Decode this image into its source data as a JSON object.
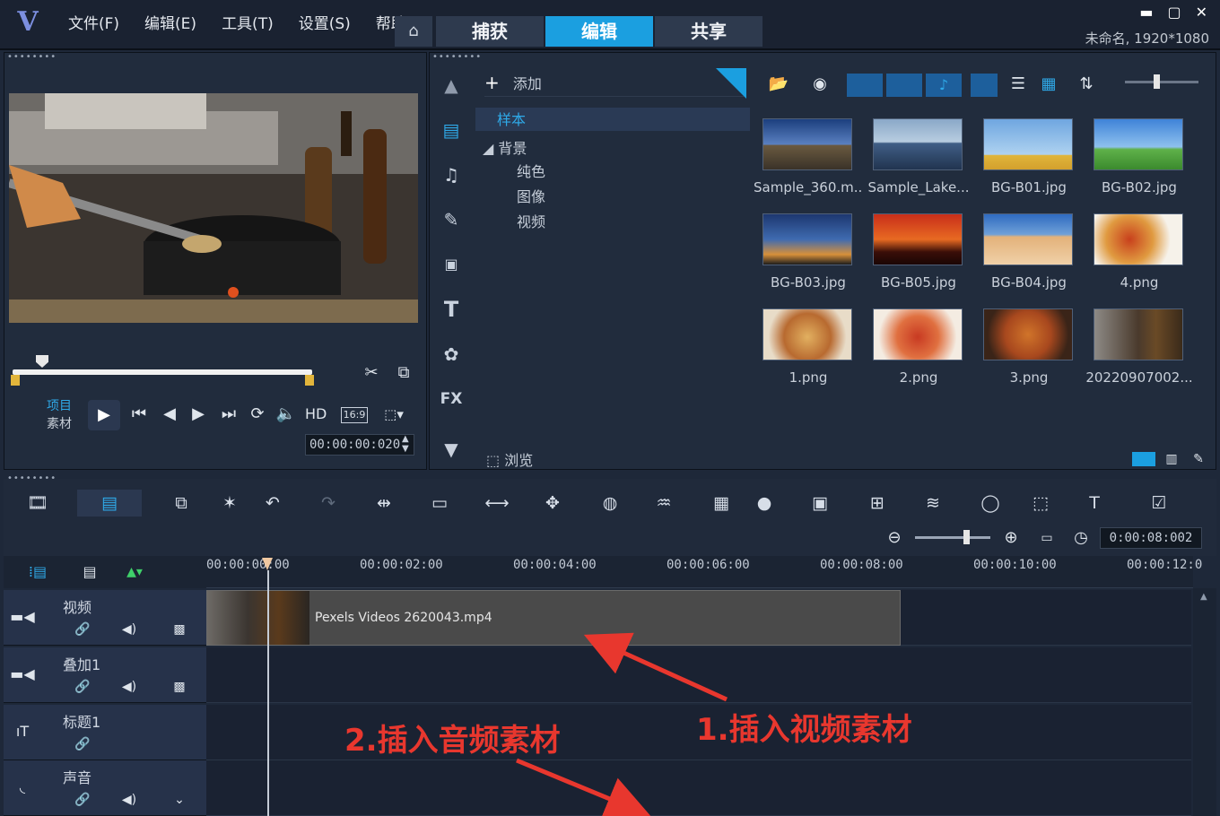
{
  "app": {
    "menu": [
      "文件(F)",
      "编辑(E)",
      "工具(T)",
      "设置(S)",
      "帮助"
    ],
    "tabs": [
      {
        "label": "捕获",
        "active": false
      },
      {
        "label": "编辑",
        "active": true
      },
      {
        "label": "共享",
        "active": false
      }
    ],
    "project_info": "未命名, 1920*1080",
    "accent_color": "#1b9fe0"
  },
  "player": {
    "mode_project": "项目",
    "mode_clip": "素材",
    "hd_label": "HD",
    "aspect_label": "16:9",
    "timecode": "00:00:00:020"
  },
  "library": {
    "add_label": "添加",
    "browse_label": "浏览",
    "tree": {
      "sample": "样本",
      "background": "背景",
      "solid_color": "纯色",
      "image": "图像",
      "video": "视频"
    },
    "thumbnails": [
      {
        "label": "Sample_360.m..."
      },
      {
        "label": "Sample_Lake..."
      },
      {
        "label": "BG-B01.jpg"
      },
      {
        "label": "BG-B02.jpg"
      },
      {
        "label": "BG-B03.jpg"
      },
      {
        "label": "BG-B05.jpg"
      },
      {
        "label": "BG-B04.jpg"
      },
      {
        "label": "4.png"
      },
      {
        "label": "1.png"
      },
      {
        "label": "2.png"
      },
      {
        "label": "3.png"
      },
      {
        "label": "20220907002..."
      }
    ]
  },
  "timeline": {
    "zoom_timecode": "0:00:08:002",
    "ruler": [
      "00:00:00:00",
      "00:00:02:00",
      "00:00:04:00",
      "00:00:06:00",
      "00:00:08:00",
      "00:00:10:00",
      "00:00:12:0"
    ],
    "tracks": [
      {
        "name": "视频"
      },
      {
        "name": "叠加1"
      },
      {
        "name": "标题1"
      },
      {
        "name": "声音"
      }
    ],
    "clip_name": "Pexels Videos 2620043.mp4"
  },
  "annotations": {
    "video_note": "1.插入视频素材",
    "audio_note": "2.插入音频素材"
  }
}
